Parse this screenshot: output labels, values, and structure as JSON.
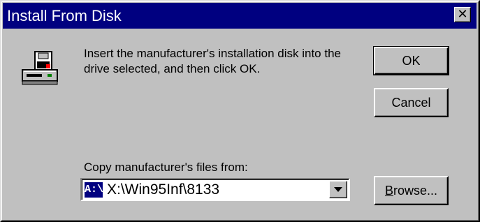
{
  "window": {
    "title": "Install From Disk",
    "close_icon": "close-icon",
    "close_glyph": "✕"
  },
  "message": {
    "icon": "floppy-drive-icon",
    "text": "Insert the manufacturer's installation disk into the drive selected, and then click OK."
  },
  "buttons": {
    "ok_label": "OK",
    "cancel_label": "Cancel",
    "browse_mnemonic": "B",
    "browse_rest": "rowse..."
  },
  "copy_from": {
    "label": "Copy manufacturer's files from:",
    "drive_icon_text": "A:\\",
    "value": "X:\\Win95Inf\\8133",
    "dropdown_icon": "dropdown-arrow-icon"
  },
  "colors": {
    "titlebar": "#000080",
    "face": "#c0c0c0",
    "highlight": "#ffffff",
    "shadow": "#808080"
  }
}
